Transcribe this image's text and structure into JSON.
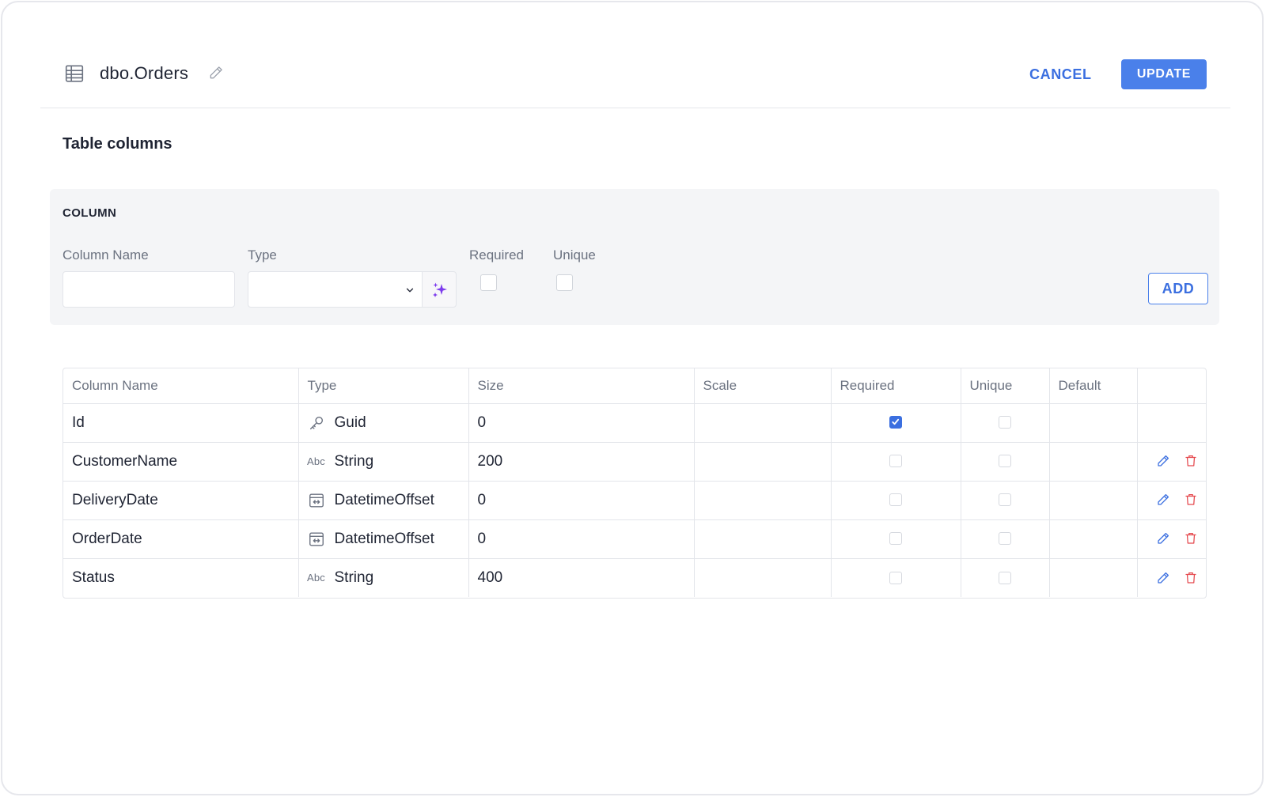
{
  "header": {
    "table_name": "dbo.Orders",
    "cancel_label": "CANCEL",
    "update_label": "UPDATE"
  },
  "section_title": "Table columns",
  "add_panel": {
    "title": "COLUMN",
    "column_name_label": "Column Name",
    "type_label": "Type",
    "required_label": "Required",
    "unique_label": "Unique",
    "column_name_value": "",
    "type_value": "",
    "required_checked": false,
    "unique_checked": false,
    "add_label": "ADD"
  },
  "table": {
    "headers": [
      "Column Name",
      "Type",
      "Size",
      "Scale",
      "Required",
      "Unique",
      "Default",
      ""
    ],
    "rows": [
      {
        "name": "Id",
        "type": "Guid",
        "type_icon": "key-icon",
        "size": "0",
        "scale": "",
        "required": true,
        "unique": false,
        "default": "",
        "editable": false
      },
      {
        "name": "CustomerName",
        "type": "String",
        "type_icon": "abc-icon",
        "type_icon_text": "Abc",
        "size": "200",
        "scale": "",
        "required": false,
        "unique": false,
        "default": "",
        "editable": true
      },
      {
        "name": "DeliveryDate",
        "type": "DatetimeOffset",
        "type_icon": "calendar-icon",
        "size": "0",
        "scale": "",
        "required": false,
        "unique": false,
        "default": "",
        "editable": true
      },
      {
        "name": "OrderDate",
        "type": "DatetimeOffset",
        "type_icon": "calendar-icon",
        "size": "0",
        "scale": "",
        "required": false,
        "unique": false,
        "default": "",
        "editable": true
      },
      {
        "name": "Status",
        "type": "String",
        "type_icon": "abc-icon",
        "type_icon_text": "Abc",
        "size": "400",
        "scale": "",
        "required": false,
        "unique": false,
        "default": "",
        "editable": true
      }
    ]
  },
  "colors": {
    "accent": "#4a80ea",
    "link": "#3b6fe0",
    "delete": "#e5484d",
    "ai_sparkle": "#7c3aed"
  }
}
